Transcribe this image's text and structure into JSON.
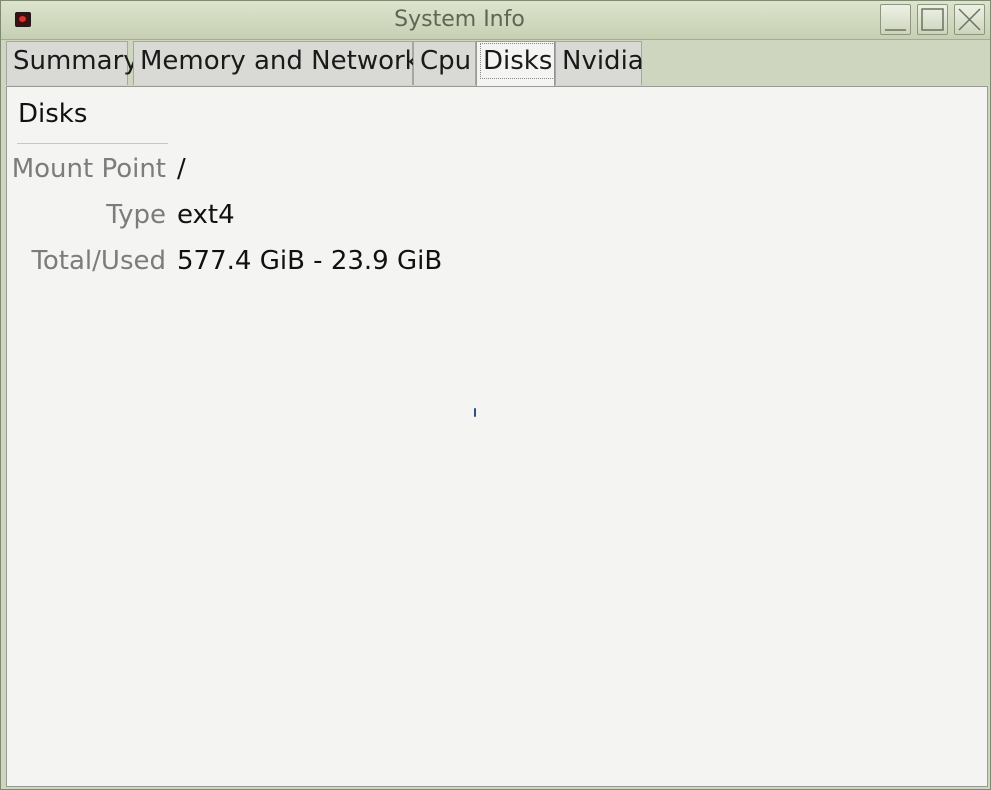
{
  "window": {
    "title": "System Info",
    "icon": "app-icon",
    "controls": [
      "minimize-icon",
      "maximize-icon",
      "close-icon"
    ]
  },
  "tabs": [
    {
      "label": "Summary",
      "active": false
    },
    {
      "label": "Memory and Network",
      "active": false
    },
    {
      "label": "Cpu",
      "active": false
    },
    {
      "label": "Disks",
      "active": true
    },
    {
      "label": "Nvidia",
      "active": false
    }
  ],
  "disks": {
    "section_title": "Disks",
    "rows": [
      {
        "label": "Mount Point",
        "value": "/"
      },
      {
        "label": "Type",
        "value": "ext4"
      },
      {
        "label": "Total/Used",
        "value": "577.4 GiB - 23.9 GiB"
      }
    ]
  },
  "colors": {
    "titlebar": "#cfd6c0",
    "panel_bg": "#f4f4f2",
    "label_text": "#7c7c7c",
    "value_text": "#111111"
  }
}
